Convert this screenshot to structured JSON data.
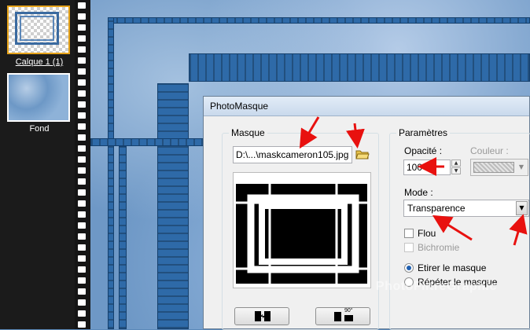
{
  "layers": [
    {
      "label": "Calque 1 (1)",
      "selected": true
    },
    {
      "label": "Fond",
      "selected": false
    }
  ],
  "dialog": {
    "title": "PhotoMasque",
    "masque": {
      "group_title": "Masque",
      "file_value": "D:\\...\\maskcameron105.jpg"
    },
    "params": {
      "group_title": "Paramètres",
      "opacity_label": "Opacité :",
      "opacity_value": "100",
      "color_label": "Couleur :",
      "mode_label": "Mode :",
      "mode_value": "Transparence",
      "flou_label": "Flou",
      "bichromie_label": "Bichromie",
      "stretch_label": "Etirer le masque",
      "repeat_label": "Répéter le masque",
      "selected_option": "Etirer le masque"
    },
    "buttons": {
      "invert_icon": "invert-mask-icon",
      "rotate_text": "90°"
    }
  },
  "watermark": "PhotoFiltreGraphic",
  "colors": {
    "arrow": "#e8110f",
    "selected_layer_border": "#e5a21a",
    "canvas_blue": "#6e98c6",
    "band_blue": "#2e6aa8"
  }
}
